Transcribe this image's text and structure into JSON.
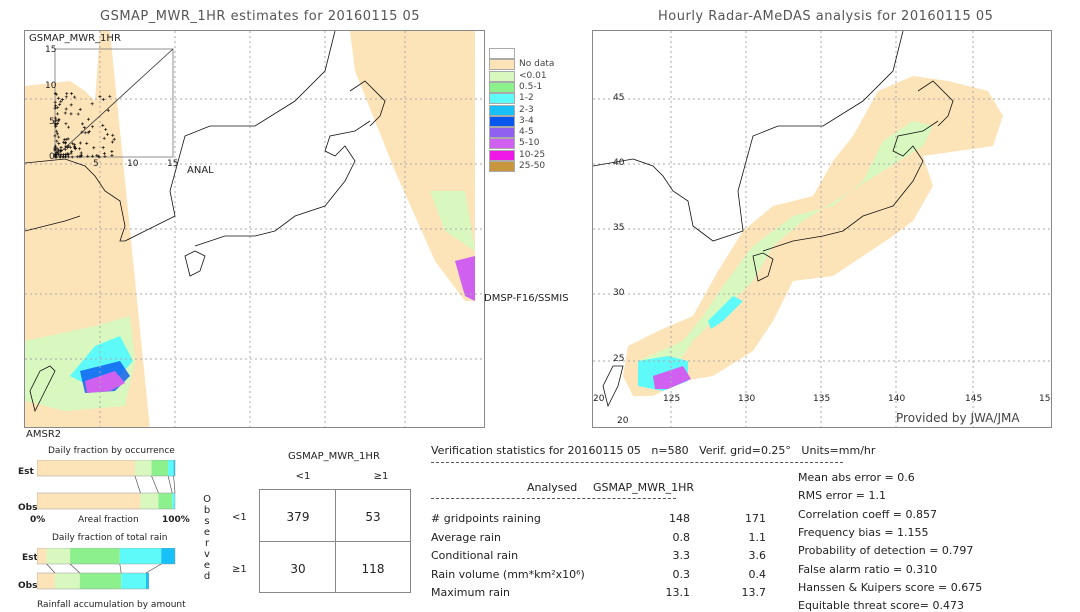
{
  "left_panel": {
    "title": "GSMAP_MWR_1HR estimates for 20160115 05",
    "inset_label": "GSMAP_MWR_1HR",
    "inset_y_ticks": [
      "15",
      "10",
      "5",
      "0"
    ],
    "inset_x_ticks": [
      "5",
      "10",
      "15"
    ],
    "inset_x_label": "ANAL",
    "sensor_left": "AMSR2",
    "sensor_right": "DMSP-F16/SSMIS"
  },
  "right_panel": {
    "title": "Hourly Radar-AMeDAS analysis for 20160115 05",
    "lat_ticks": [
      "45",
      "40",
      "35",
      "30",
      "25",
      "20"
    ],
    "lon_ticks": [
      "20",
      "125",
      "130",
      "135",
      "140",
      "145",
      "15"
    ],
    "credit": "Provided by JWA/JMA"
  },
  "legend": {
    "items": [
      {
        "label": "",
        "color": "#ffffff"
      },
      {
        "label": "No data",
        "color": "#fde3b8"
      },
      {
        "label": "<0.01",
        "color": "#d8f8c0"
      },
      {
        "label": "0.5-1",
        "color": "#8cf08c"
      },
      {
        "label": "1-2",
        "color": "#5efafa"
      },
      {
        "label": "2-3",
        "color": "#18c0f8"
      },
      {
        "label": "3-4",
        "color": "#0858f0"
      },
      {
        "label": "4-5",
        "color": "#9060f0"
      },
      {
        "label": "5-10",
        "color": "#d060f0"
      },
      {
        "label": "10-25",
        "color": "#f018e8"
      },
      {
        "label": "25-50",
        "color": "#c8963c"
      }
    ]
  },
  "fraction_charts": {
    "occurrence_title": "Daily fraction by occurrence",
    "occurrence_xlabel": "Areal fraction",
    "x_min_label": "0%",
    "x_max_label": "100%",
    "rain_title": "Daily fraction of total rain",
    "rain_xlabel": "Rainfall accumulation by amount",
    "est_label": "Est",
    "obs_label": "Obs"
  },
  "contingency": {
    "header": "GSMAP_MWR_1HR",
    "col_labels": [
      "<1",
      "≥1"
    ],
    "row_labels": [
      "<1",
      "≥1"
    ],
    "side_label": "Observed",
    "cells": [
      [
        "379",
        "53"
      ],
      [
        "30",
        "118"
      ]
    ]
  },
  "verification": {
    "header": "Verification statistics for 20160115 05   n=580   Verif. grid=0.25°   Units=mm/hr",
    "col_analysed": "Analysed",
    "col_gsmap": "GSMAP_MWR_1HR",
    "rows": [
      {
        "label": "# gridpoints raining",
        "analysed": "148",
        "gsmap": "171"
      },
      {
        "label": "Average rain",
        "analysed": "0.8",
        "gsmap": "1.1"
      },
      {
        "label": "Conditional rain",
        "analysed": "3.3",
        "gsmap": "3.6"
      },
      {
        "label": "Rain volume (mm*km²x10⁶)",
        "analysed": "0.3",
        "gsmap": "0.4"
      },
      {
        "label": "Maximum rain",
        "analysed": "13.1",
        "gsmap": "13.7"
      }
    ],
    "scores": [
      "Mean abs error = 0.6",
      "RMS error = 1.1",
      "Correlation coeff = 0.857",
      "Frequency bias = 1.155",
      "Probability of detection = 0.797",
      "False alarm ratio = 0.310",
      "Hanssen & Kuipers score = 0.675",
      "Equitable threat score= 0.473"
    ]
  },
  "chart_data": [
    {
      "type": "bar",
      "title": "Daily fraction by occurrence",
      "xlabel": "Areal fraction",
      "orientation": "horizontal-stacked",
      "xlim": [
        0,
        100
      ],
      "categories": [
        "Est",
        "Obs"
      ],
      "series": [
        {
          "name": "No data/<0.01",
          "color": "#fde3b8",
          "values": [
            71,
            75
          ]
        },
        {
          "name": "<0.01",
          "color": "#d8f8c0",
          "values": [
            12,
            13
          ]
        },
        {
          "name": "0.5-1",
          "color": "#8cf08c",
          "values": [
            12,
            10
          ]
        },
        {
          "name": "1-2",
          "color": "#5efafa",
          "values": [
            4,
            2
          ]
        },
        {
          "name": "2-3",
          "color": "#18c0f8",
          "values": [
            1,
            0
          ]
        }
      ]
    },
    {
      "type": "bar",
      "title": "Daily fraction of total rain",
      "xlabel": "Rainfall accumulation by amount",
      "orientation": "horizontal-stacked",
      "xlim": [
        0,
        100
      ],
      "categories": [
        "Est",
        "Obs"
      ],
      "series": [
        {
          "name": "No data",
          "color": "#fde3b8",
          "values": [
            7,
            13
          ]
        },
        {
          "name": "<0.01",
          "color": "#d8f8c0",
          "values": [
            17,
            18
          ]
        },
        {
          "name": "0.5-1",
          "color": "#8cf08c",
          "values": [
            36,
            30
          ]
        },
        {
          "name": "1-2",
          "color": "#5efafa",
          "values": [
            30,
            18
          ]
        },
        {
          "name": "2-3",
          "color": "#18c0f8",
          "values": [
            10,
            2
          ]
        }
      ]
    }
  ]
}
